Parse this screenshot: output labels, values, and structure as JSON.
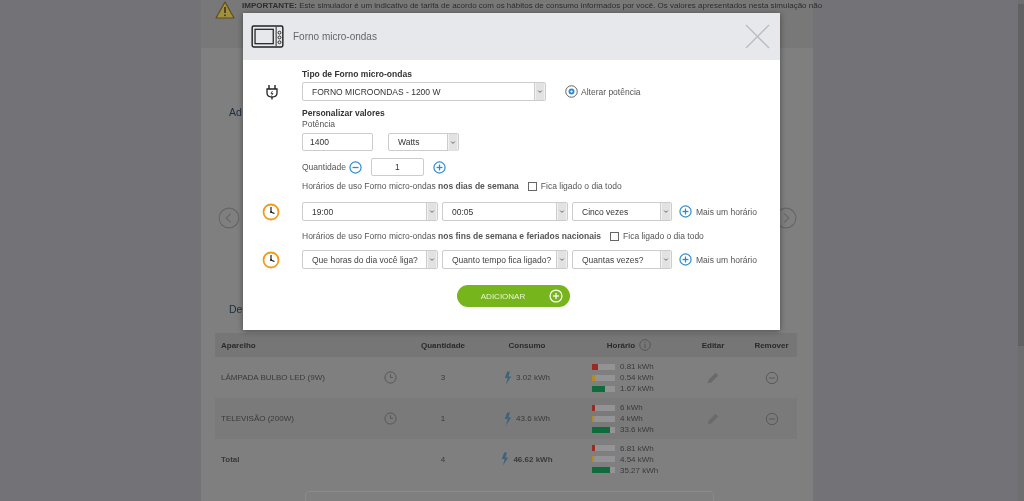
{
  "notice": {
    "text": "**IMPORTANTE:** Este simulador é um indicativo de tarifa de acordo com os hábitos de consumo informados por você. Os valores apresentados nesta simulação não"
  },
  "section_headings": [
    "Ad",
    "De"
  ],
  "table": {
    "columns": [
      "Aparelho",
      "Quantidade",
      "Consumo",
      "Horário",
      "Editar",
      "Remover"
    ],
    "rows": [
      {
        "kind": "item",
        "name": "LÂMPADA BULBO LED (9W)",
        "quantity": "3",
        "consumption": "3.02 kWh",
        "usage": [
          {
            "color": "#9b2a22",
            "level": 0.25,
            "reading": "0.81 kWh"
          },
          {
            "color": "#b38a1f",
            "level": 0.12,
            "reading": "0.54 kWh"
          },
          {
            "color": "#0f6b3a",
            "level": 0.55,
            "reading": "1.67 kWh"
          }
        ]
      },
      {
        "kind": "item",
        "name": "TELEVISÃO (200W)",
        "quantity": "1",
        "consumption": "43.6 kWh",
        "usage": [
          {
            "color": "#9b2a22",
            "level": 0.15,
            "reading": "6 kWh"
          },
          {
            "color": "#b38a1f",
            "level": 0.1,
            "reading": "4 kWh"
          },
          {
            "color": "#0f6b3a",
            "level": 0.8,
            "reading": "33.6 kWh"
          }
        ]
      },
      {
        "kind": "total",
        "name": "Total",
        "quantity": "4",
        "consumption": "46.62 kWh",
        "usage": [
          {
            "color": "#9b2a22",
            "level": 0.15,
            "reading": "6.81 kWh"
          },
          {
            "color": "#b38a1f",
            "level": 0.1,
            "reading": "4.54 kWh"
          },
          {
            "color": "#0f6b3a",
            "level": 0.8,
            "reading": "35.27 kWh"
          }
        ]
      }
    ]
  },
  "modal": {
    "title": "Forno micro-ondas",
    "type_label": "Tipo de Forno micro-ondas",
    "type_select": {
      "value": "FORNO MICROONDAS - 1200 W"
    },
    "change_power": "Alterar potência",
    "customize_label": "Personalizar valores",
    "power_label": "Potência",
    "power": {
      "value": "1400"
    },
    "unit_select": {
      "value": "Watts"
    },
    "quantity_label": "Quantidade",
    "quantity": {
      "value": "1"
    },
    "schedules": [
      {
        "label": "Horários de uso Forno micro-ondas **nos dias de semana**",
        "all_day": {
          "label": "Fica ligado o dia todo",
          "checked": false
        },
        "selects": [
          {
            "value": "19:00"
          },
          {
            "value": "00:05"
          },
          {
            "value": "Cinco vezes"
          }
        ],
        "add": "Mais um horário"
      },
      {
        "label": "Horários de uso Forno micro-ondas **nos fins de semana e feriados nacionais**",
        "all_day": {
          "label": "Fica ligado o dia todo",
          "checked": false
        },
        "selects": [
          {
            "placeholder": "Que horas do dia você liga?"
          },
          {
            "placeholder": "Quanto tempo fica ligado?"
          },
          {
            "placeholder": "Quantas vezes?"
          }
        ],
        "add": "Mais um horário"
      }
    ],
    "submit": "ADICIONAR"
  }
}
